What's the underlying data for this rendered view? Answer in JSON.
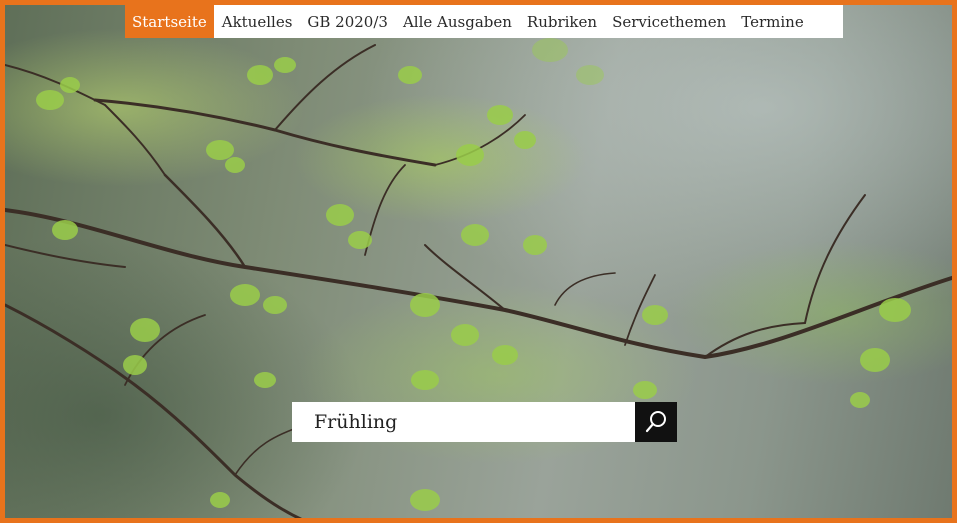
{
  "nav": {
    "items": [
      {
        "label": "Startseite",
        "active": true
      },
      {
        "label": "Aktuelles",
        "active": false
      },
      {
        "label": "GB 2020/3",
        "active": false
      },
      {
        "label": "Alle Ausgaben",
        "active": false
      },
      {
        "label": "Rubriken",
        "active": false
      },
      {
        "label": "Servicethemen",
        "active": false
      },
      {
        "label": "Termine",
        "active": false
      }
    ]
  },
  "search": {
    "value": "Frühling",
    "button_icon": "search-icon"
  },
  "colors": {
    "accent": "#e8731c",
    "nav_bg": "#ffffff",
    "search_button_bg": "#111111"
  },
  "hero": {
    "image": "spring-branch-with-young-leaves"
  }
}
